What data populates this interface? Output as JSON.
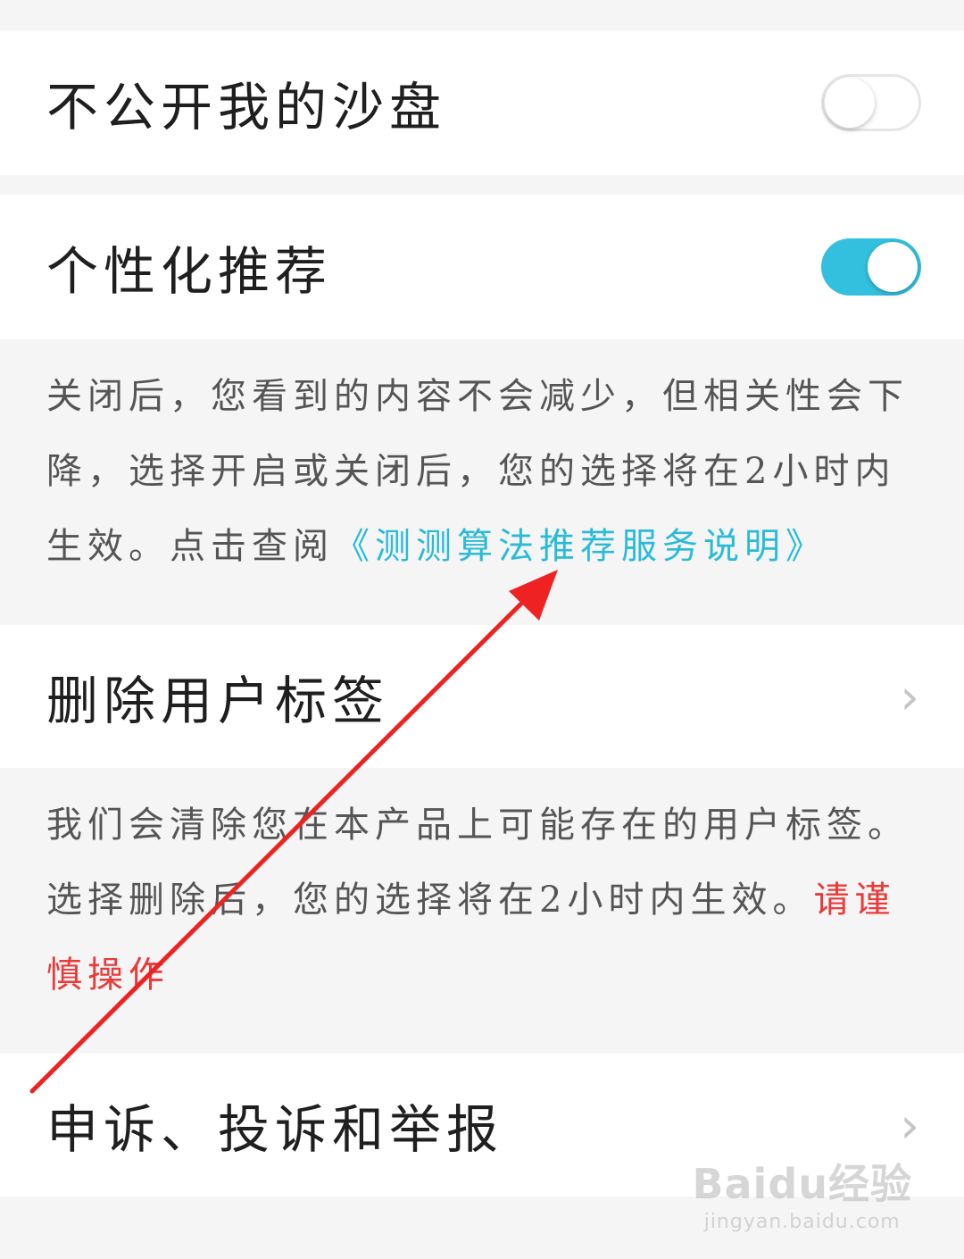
{
  "settings": {
    "hide_sandbox": {
      "label": "不公开我的沙盘",
      "toggle_on": false
    },
    "personalized": {
      "label": "个性化推荐",
      "toggle_on": true,
      "desc_part1": "关闭后，您看到的内容不会减少，但相关性会下降，选择开启或关闭后，您的选择将在2小时内生效。点击查阅",
      "desc_link": "《测测算法推荐服务说明》"
    },
    "delete_tags": {
      "label": "删除用户标签",
      "desc_part1": "我们会清除您在本产品上可能存在的用户标签。选择删除后，您的选择将在2小时内生效。",
      "desc_warning": "请谨慎操作"
    },
    "appeal": {
      "label": "申诉、投诉和举报"
    }
  },
  "icons": {
    "chevron": "chevron-right-icon"
  },
  "colors": {
    "toggle_on": "#33c0de",
    "link": "#2bbbd8",
    "warning": "#ea3a3a",
    "annotation_arrow": "#ee2222"
  },
  "watermark": {
    "main": "Baidu经验",
    "sub": "jingyan.baidu.com"
  }
}
